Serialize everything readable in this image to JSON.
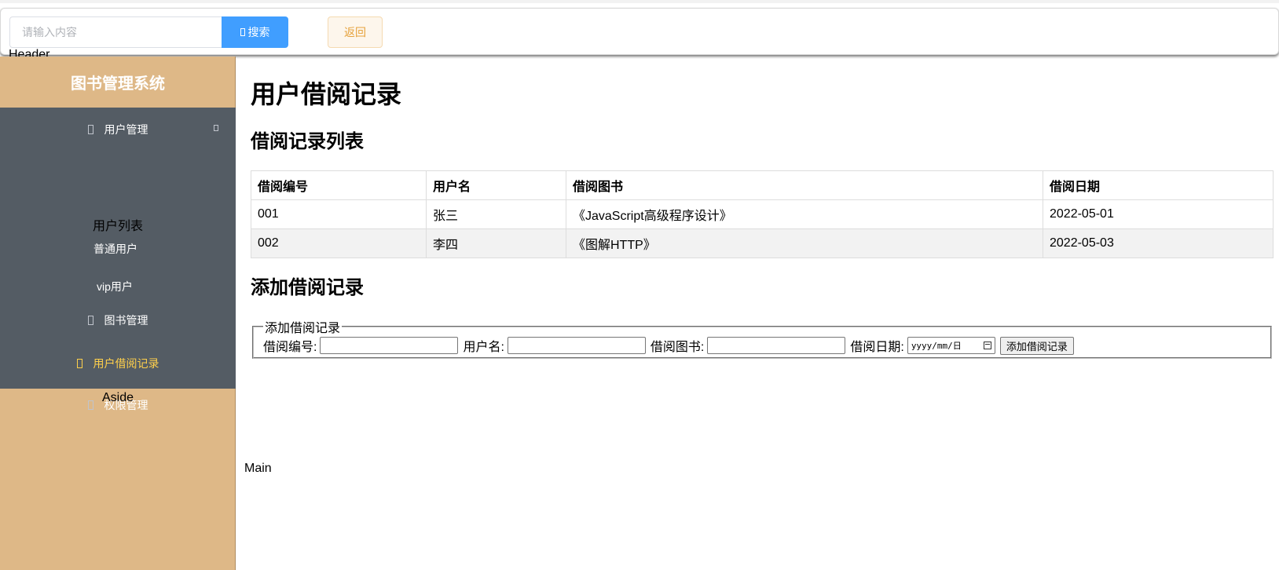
{
  "header": {
    "search_placeholder": "请输入内容",
    "search_button_label": "搜索",
    "back_button_label": "返回",
    "region_label": "Header"
  },
  "aside": {
    "title": "图书管理系统",
    "menu": {
      "user_management": "用户管理",
      "user_list_group": "用户列表",
      "regular_users": "普通用户",
      "vip_users": "vip用户",
      "book_management": "图书管理",
      "borrow_records": "用户借阅记录",
      "permission_management": "权限管理"
    },
    "region_label": "Aside",
    "menu_background": "#545c64",
    "active_color": "#ffd04b",
    "aside_background": "#deb887"
  },
  "main": {
    "page_title": "用户借阅记录",
    "list_section_title": "借阅记录列表",
    "table": {
      "headers": [
        "借阅编号",
        "用户名",
        "借阅图书",
        "借阅日期"
      ],
      "rows": [
        [
          "001",
          "张三",
          "《JavaScript高级程序设计》",
          "2022-05-01"
        ],
        [
          "002",
          "李四",
          "《图解HTTP》",
          "2022-05-03"
        ]
      ]
    },
    "add_section_title": "添加借阅记录",
    "form": {
      "legend": "添加借阅记录",
      "borrow_id_label": "借阅编号:",
      "username_label": "用户名:",
      "book_label": "借阅图书:",
      "date_label": "借阅日期:",
      "date_placeholder": "yyyy/mm/日",
      "submit_label": "添加借阅记录"
    },
    "region_label": "Main"
  }
}
